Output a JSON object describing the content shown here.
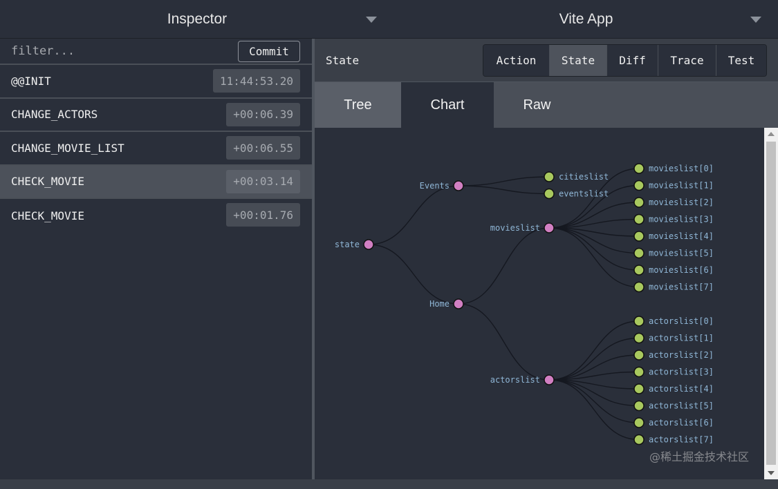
{
  "top": {
    "left_title": "Inspector",
    "right_title": "Vite App"
  },
  "left": {
    "filter_placeholder": "filter...",
    "commit_label": "Commit",
    "actions": [
      {
        "name": "@@INIT",
        "time": "11:44:53.20"
      },
      {
        "name": "CHANGE_ACTORS",
        "time": "+00:06.39"
      },
      {
        "name": "CHANGE_MOVIE_LIST",
        "time": "+00:06.55"
      },
      {
        "name": "CHECK_MOVIE",
        "time": "+00:03.14",
        "selected": true
      },
      {
        "name": "CHECK_MOVIE",
        "time": "+00:01.76"
      }
    ]
  },
  "right": {
    "header_title": "State",
    "buttons": [
      {
        "label": "Action"
      },
      {
        "label": "State",
        "active": true
      },
      {
        "label": "Diff"
      },
      {
        "label": "Trace"
      },
      {
        "label": "Test"
      }
    ],
    "tabs": [
      {
        "label": "Tree"
      },
      {
        "label": "Chart",
        "active": true
      },
      {
        "label": "Raw"
      }
    ]
  },
  "tree": {
    "root": "state",
    "branches": [
      {
        "name": "Events",
        "children": [
          "citieslist",
          "eventslist"
        ]
      },
      {
        "name": "Home",
        "children": [
          {
            "name": "movieslist",
            "children": [
              "movieslist[0]",
              "movieslist[1]",
              "movieslist[2]",
              "movieslist[3]",
              "movieslist[4]",
              "movieslist[5]",
              "movieslist[6]",
              "movieslist[7]"
            ]
          },
          {
            "name": "actorslist",
            "children": [
              "actorslist[0]",
              "actorslist[1]",
              "actorslist[2]",
              "actorslist[3]",
              "actorslist[4]",
              "actorslist[5]",
              "actorslist[6]",
              "actorslist[7]"
            ]
          }
        ]
      }
    ]
  },
  "colors": {
    "node_parent": "#d17fc2",
    "node_leaf": "#a8c85e",
    "label": "#8fb6d6",
    "link": "#151820"
  },
  "watermark": "@稀土掘金技术社区"
}
